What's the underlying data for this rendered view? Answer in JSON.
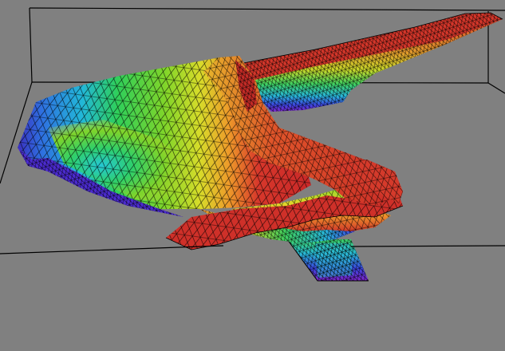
{
  "scene": {
    "background_color": "#808080",
    "box_edge_color": "#000000",
    "mesh_line_color": "#000000",
    "colormap": [
      "#6a1fb5",
      "#3a3adf",
      "#2a8be8",
      "#22d0d8",
      "#2fcf5a",
      "#7fdc2a",
      "#e6e12a",
      "#f19a2a",
      "#d7372b"
    ]
  }
}
